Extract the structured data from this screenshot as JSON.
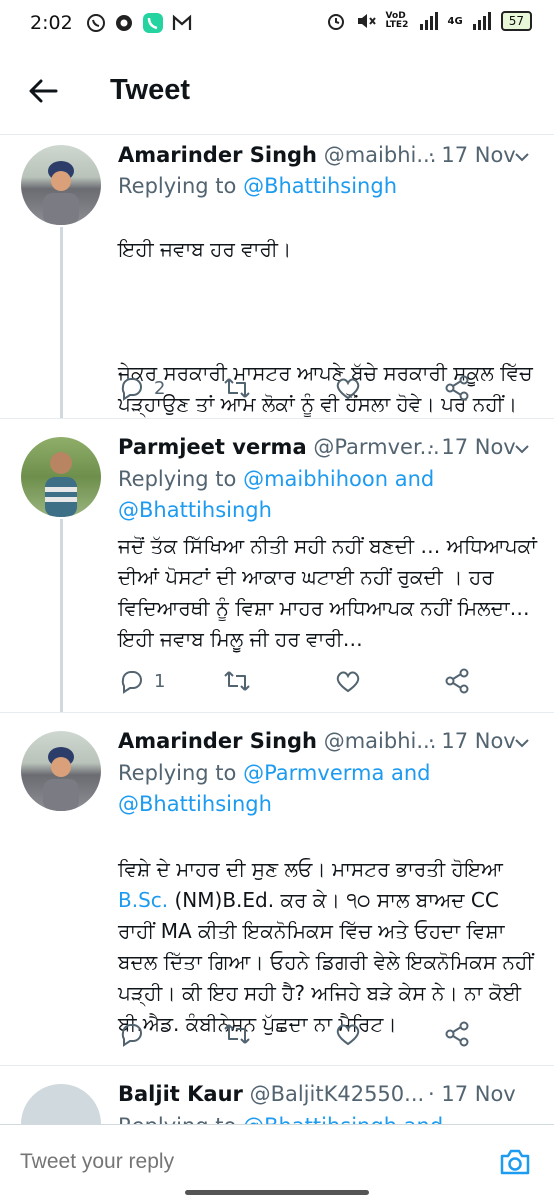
{
  "status_bar": {
    "time": "2:02",
    "carrier_tag": "VoD LTE2",
    "network": "4G",
    "battery": "57"
  },
  "header": {
    "title": "Tweet"
  },
  "tweets": [
    {
      "name": "Amarinder Singh",
      "handle": "@maibhi...",
      "date": "· 17 Nov",
      "replying_prefix": "Replying to ",
      "replying_to": "@Bhattihsingh",
      "text_line1": "ਇਹੀ ਜਵਾਬ ਹਰ ਵਾਰੀ।",
      "text_line2": "ਜੇਕਰ ਸਰਕਾਰੀ ਮਾਸਟਰ ਆਪਣੇ ਬੱਚੇ ਸਰਕਾਰੀ ਸਕੂਲ ਵਿੱਚ ਪੜ੍ਹਾਉਣ ਤਾਂ ਆਮ ਲੋਕਾਂ ਨੂੰ ਵੀ ਹੌਂਸਲਾ ਹੋਵੇ। ਪਰ ਨਹੀਂ।",
      "reply_count": "2"
    },
    {
      "name": "Parmjeet verma",
      "handle": "@Parmver...",
      "date": "· 17 Nov",
      "replying_prefix": "Replying to ",
      "replying_to": "@maibhihoon and @Bhattihsingh",
      "text": "ਜਦੋਂ ਤੱਕ ਸਿੱਖਿਆ ਨੀਤੀ ਸਹੀ ਨਹੀਂ ਬਣਦੀ … ਅਧਿਆਪਕਾਂ ਦੀਆਂ ਪੋਸਟਾਂ ਦੀ ਆਕਾਰ ਘਟਾਈ ਨਹੀਂ ਰੁਕਦੀ । ਹਰ ਵਿਦਿਆਰਥੀ ਨੂੰ ਵਿਸ਼ਾ ਮਾਹਰ ਅਧਿਆਪਕ ਨਹੀਂ ਮਿਲਦਾ… ਇਹੀ ਜਵਾਬ ਮਿਲੂ ਜੀ ਹਰ ਵਾਰੀ…",
      "reply_count": "1"
    },
    {
      "name": "Amarinder Singh",
      "handle": "@maibhi...",
      "date": "· 17 Nov",
      "replying_prefix": "Replying to ",
      "replying_to": "@Parmverma and @Bhattihsingh",
      "text_before_link": "ਵਿਸ਼ੇ ਦੇ ਮਾਹਰ ਦੀ ਸੁਣ ਲਓ। ਮਾਸਟਰ ਭਾਰਤੀ ਹੋਇਆ ",
      "text_link": "B.Sc.",
      "text_after_link": " (NM)B.Ed. ਕਰ ਕੇ। ੧੦ ਸਾਲ ਬਾਅਦ CC ਰਾਹੀਂ MA ਕੀਤੀ ਇਕਨੋਮਿਕਸ ਵਿੱਚ ਅਤੇ ਓਹਦਾ ਵਿਸ਼ਾ ਬਦਲ ਦਿੱਤਾ ਗਿਆ। ਓਹਨੇ ਡਿਗਰੀ ਵੇਲੇ ਇਕਨੋਮਿਕਸ ਨਹੀਂ ਪੜ੍ਹੀ। ਕੀ ਇਹ ਸਹੀ ਹੈ? ਅਜਿਹੇ ਬੜੇ ਕੇਸ ਨੇ। ਨਾ ਕੋਈ ਬੀ.ਐਡ. ਕੰਬੀਨੇਸ਼ਨ ਪੁੱਛਦਾ ਨਾ ਮੈਰਿਟ।",
      "reply_count": ""
    },
    {
      "name": "Baljit Kaur",
      "handle": "@BaljitK42550...",
      "date": "· 17 Nov",
      "replying_prefix": "Replying to ",
      "replying_to": "@Bhattihsingh and"
    }
  ],
  "composer": {
    "placeholder": "Tweet your reply"
  },
  "colors": {
    "accent": "#1d9bf0",
    "muted": "#536471",
    "divider": "#e6ecf0"
  }
}
